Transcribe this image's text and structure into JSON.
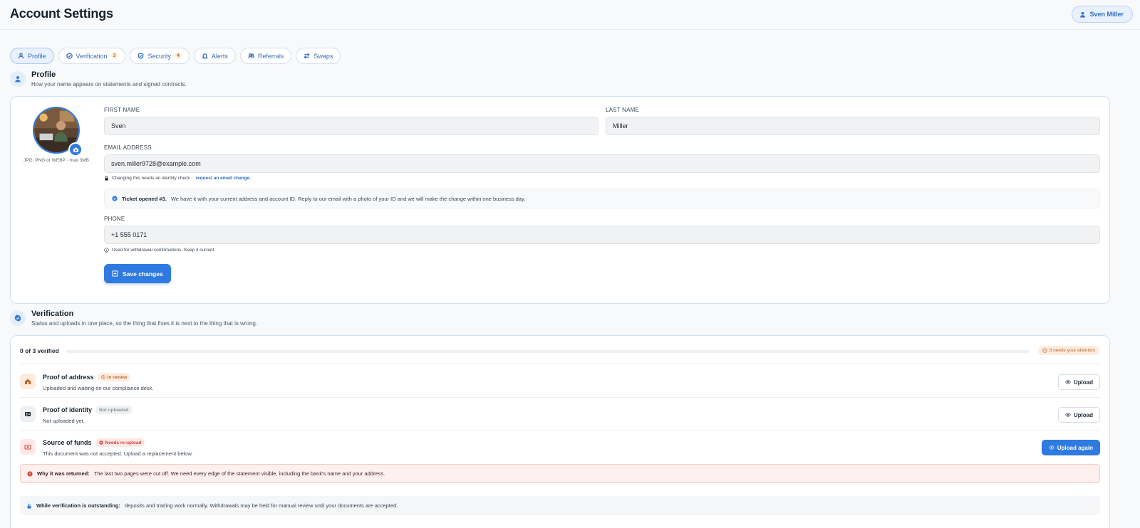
{
  "header": {
    "title": "Account Settings",
    "user_name": "Sven Miller"
  },
  "tabs": [
    {
      "label": "Profile",
      "icon": "user-icon",
      "active": true
    },
    {
      "label": "Verification",
      "icon": "check-circle-icon",
      "count": "3"
    },
    {
      "label": "Security",
      "icon": "shield-icon",
      "count": "4"
    },
    {
      "label": "Alerts",
      "icon": "bell-icon"
    },
    {
      "label": "Referrals",
      "icon": "users-icon"
    },
    {
      "label": "Swaps",
      "icon": "swap-icon"
    }
  ],
  "profile": {
    "title": "Profile",
    "subtitle": "How your name appears on statements and signed contracts.",
    "avatar_hint": "JPG, PNG or WEBP · max 3MB",
    "first_name_label": "FIRST NAME",
    "first_name": "Sven",
    "last_name_label": "LAST NAME",
    "last_name": "Miller",
    "email_label": "EMAIL ADDRESS",
    "email": "sven.miller9728@example.com",
    "email_helper": "Changing this needs an identity check ·",
    "email_change_link": "request an email change.",
    "ticket_bold": "Ticket opened #3.",
    "ticket_text": "We have it with your current address and account ID. Reply to our email with a photo of your ID and we will make the change within one business day.",
    "phone_label": "PHONE",
    "phone": "+1 555 0171",
    "phone_helper": "Used for withdrawal confirmations. Keep it current.",
    "save_label": "Save changes"
  },
  "verification": {
    "title": "Verification",
    "subtitle": "Status and uploads in one place, so the thing that fixes it is next to the thing that is wrong.",
    "progress_text": "0 of 3 verified",
    "progress_fraction": 0,
    "attention_badge": "3 needs your attention",
    "docs": [
      {
        "title": "Proof of address",
        "status": "In review",
        "status_color": "#c0651f",
        "subtitle": "Uploaded and waiting on our compliance desk.",
        "button": "Upload",
        "icon": "house-icon"
      },
      {
        "title": "Proof of identity",
        "status": "Not uploaded",
        "status_color": "#8a929b",
        "subtitle": "Not uploaded yet.",
        "button": "Upload",
        "icon": "id-card-icon"
      },
      {
        "title": "Source of funds",
        "status": "Needs re-upload",
        "status_color": "#d2433a",
        "subtitle": "This document was not accepted. Upload a replacement below.",
        "button": "Upload again",
        "icon": "banknote-icon"
      }
    ],
    "reason_bold": "Why it was returned:",
    "reason_text": "The last two pages were cut off. We need every edge of the statement visible, including the bank's name and your address.",
    "outstanding_bold": "While verification is outstanding:",
    "outstanding_text": "deposits and trading work normally. Withdrawals may be held for manual review until your documents are accepted."
  },
  "colors": {
    "accent": "#2f7ae0",
    "warning": "#c0651f",
    "danger": "#d2433a"
  }
}
